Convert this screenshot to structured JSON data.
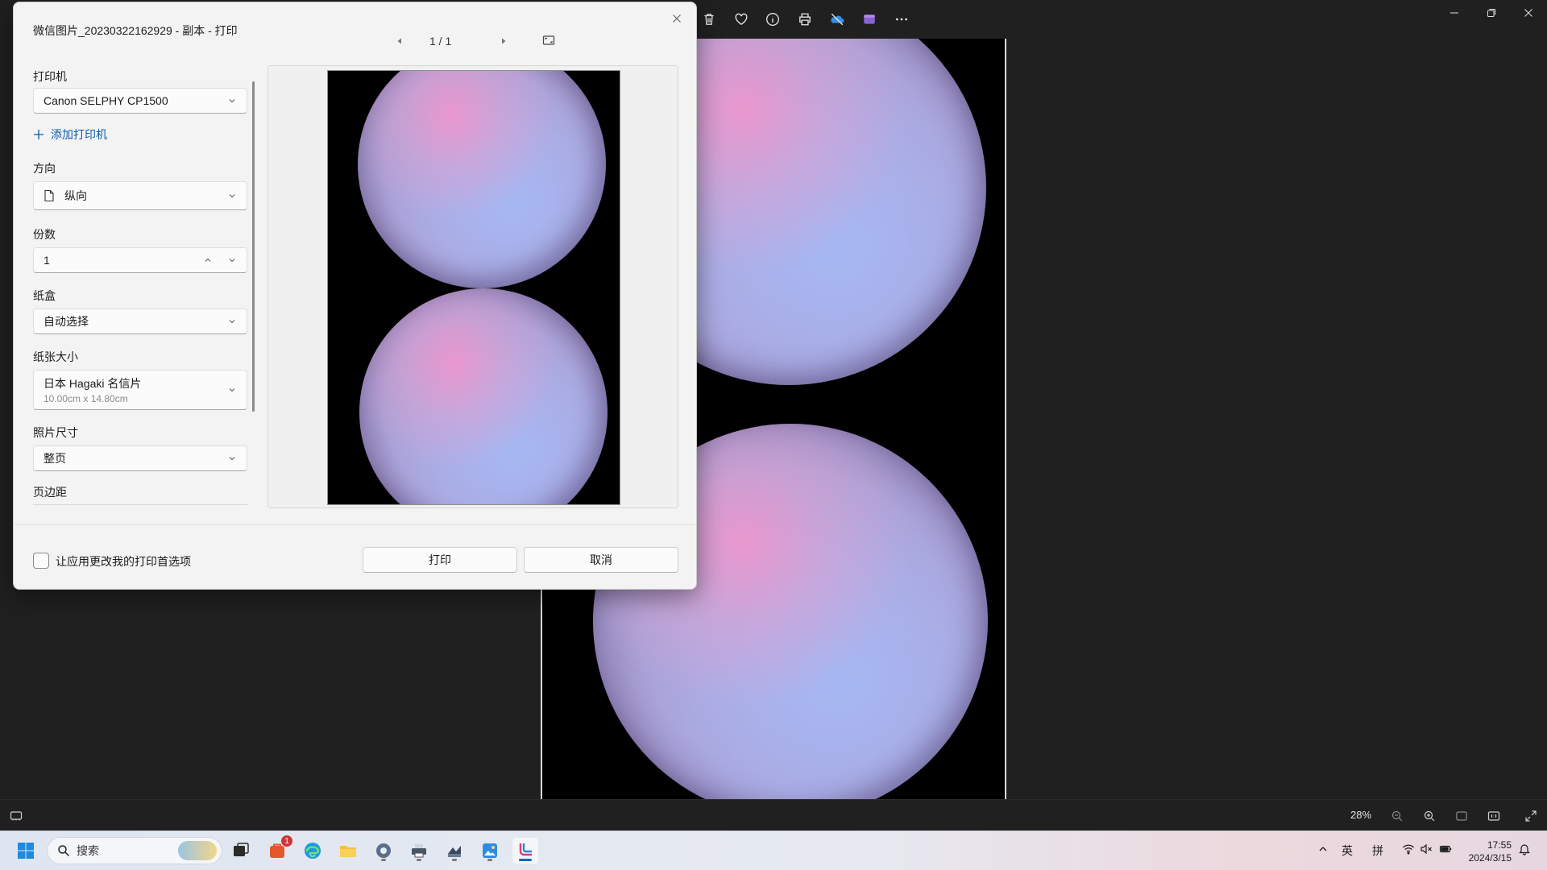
{
  "dialog": {
    "title": "微信图片_20230322162929 - 副本 - 打印",
    "page_indicator": "1 / 1",
    "sections": {
      "printer_label": "打印机",
      "printer_value": "Canon SELPHY CP1500",
      "add_printer": "添加打印机",
      "orientation_label": "方向",
      "orientation_value": "纵向",
      "copies_label": "份数",
      "copies_value": "1",
      "tray_label": "纸盒",
      "tray_value": "自动选择",
      "paper_size_label": "纸张大小",
      "paper_size_value": "日本 Hagaki 名信片",
      "paper_size_dims": "10.00cm x 14.80cm",
      "photo_size_label": "照片尺寸",
      "photo_size_value": "整页",
      "margins_label": "页边距"
    },
    "footer": {
      "allow_label": "让应用更改我的打印首选项",
      "print_button": "打印",
      "cancel_button": "取消"
    }
  },
  "photos_app": {
    "zoom_level": "28%"
  },
  "taskbar": {
    "search_placeholder": "搜索",
    "mail_badge": "1",
    "ime_lang": "英",
    "ime_mode": "拼",
    "time": "17:55",
    "date": "2024/3/15"
  },
  "colors": {
    "accent": "#0067c0",
    "link": "#0b5cad",
    "dialog_bg": "#f3f3f3",
    "app_bg": "#202020"
  }
}
